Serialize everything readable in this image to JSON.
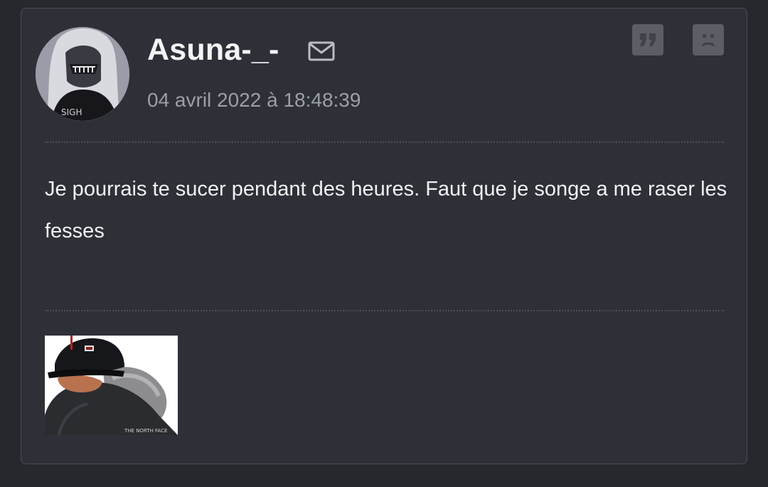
{
  "post": {
    "author": "Asuna-_-",
    "date": "04 avril 2022 à 18:48:39",
    "message": "Je pourrais te sucer pendant des heures. Faut que je songe a me raser les fesses",
    "icons": {
      "mail": "envelope-icon",
      "quote": "quote-icon",
      "report": "sad-face-icon"
    }
  },
  "colors": {
    "background": "#26282d",
    "card": "#2e3037",
    "author_text": "#f4f4f6",
    "date_text": "#9c9fa7",
    "button": "#5b5e65"
  }
}
